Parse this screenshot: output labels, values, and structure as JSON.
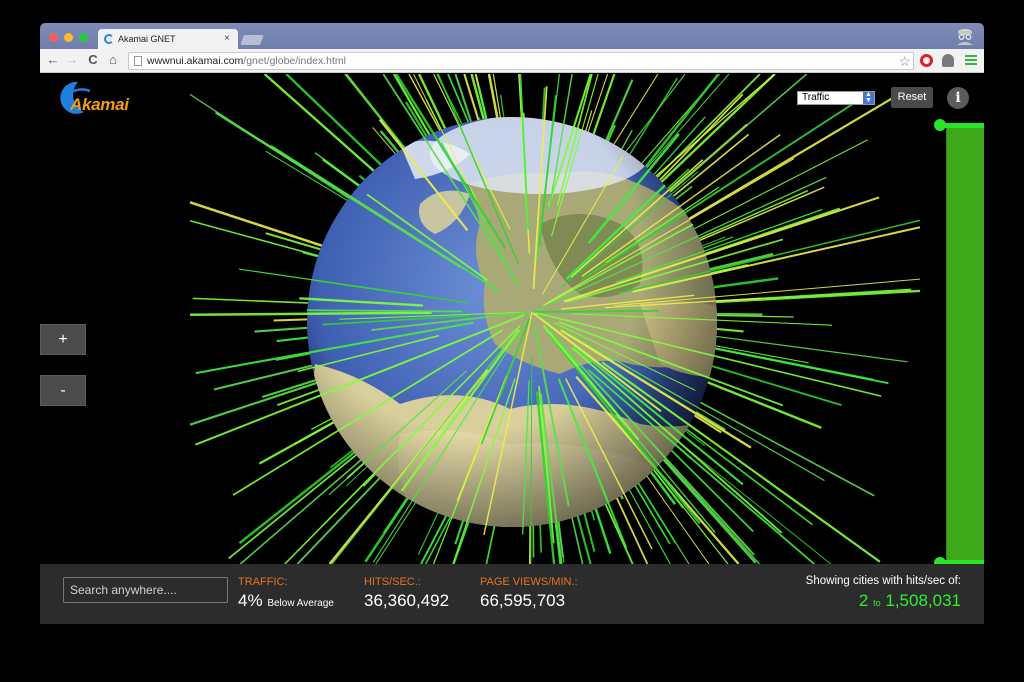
{
  "browser": {
    "tab_title": "Akamai GNET",
    "tab_close": "×",
    "url_host": "wwwnui.akamai.com",
    "url_path": "/gnet/globe/index.html",
    "nav": {
      "back": "←",
      "forward": "→",
      "reload": "C",
      "home": "⌂"
    },
    "star": "☆"
  },
  "app": {
    "logo_text": "Akamai",
    "view_select": "Traffic",
    "reset_label": "Reset",
    "info_label": "i",
    "zoom_in": "+",
    "zoom_out": "-",
    "accent_orange": "#e27422",
    "accent_green": "#2ef02e"
  },
  "stats": {
    "search_placeholder": "Search anywhere....",
    "traffic_label": "TRAFFIC:",
    "traffic_value": "4%",
    "traffic_note": "Below Average",
    "hits_label": "HITS/SEC.:",
    "hits_value": "36,360,492",
    "pageviews_label": "PAGE VIEWS/MIN.:",
    "pageviews_value": "66,595,703",
    "showing_label": "Showing cities with hits/sec of:",
    "range_min": "2",
    "range_to": "to",
    "range_max": "1,508,031"
  }
}
